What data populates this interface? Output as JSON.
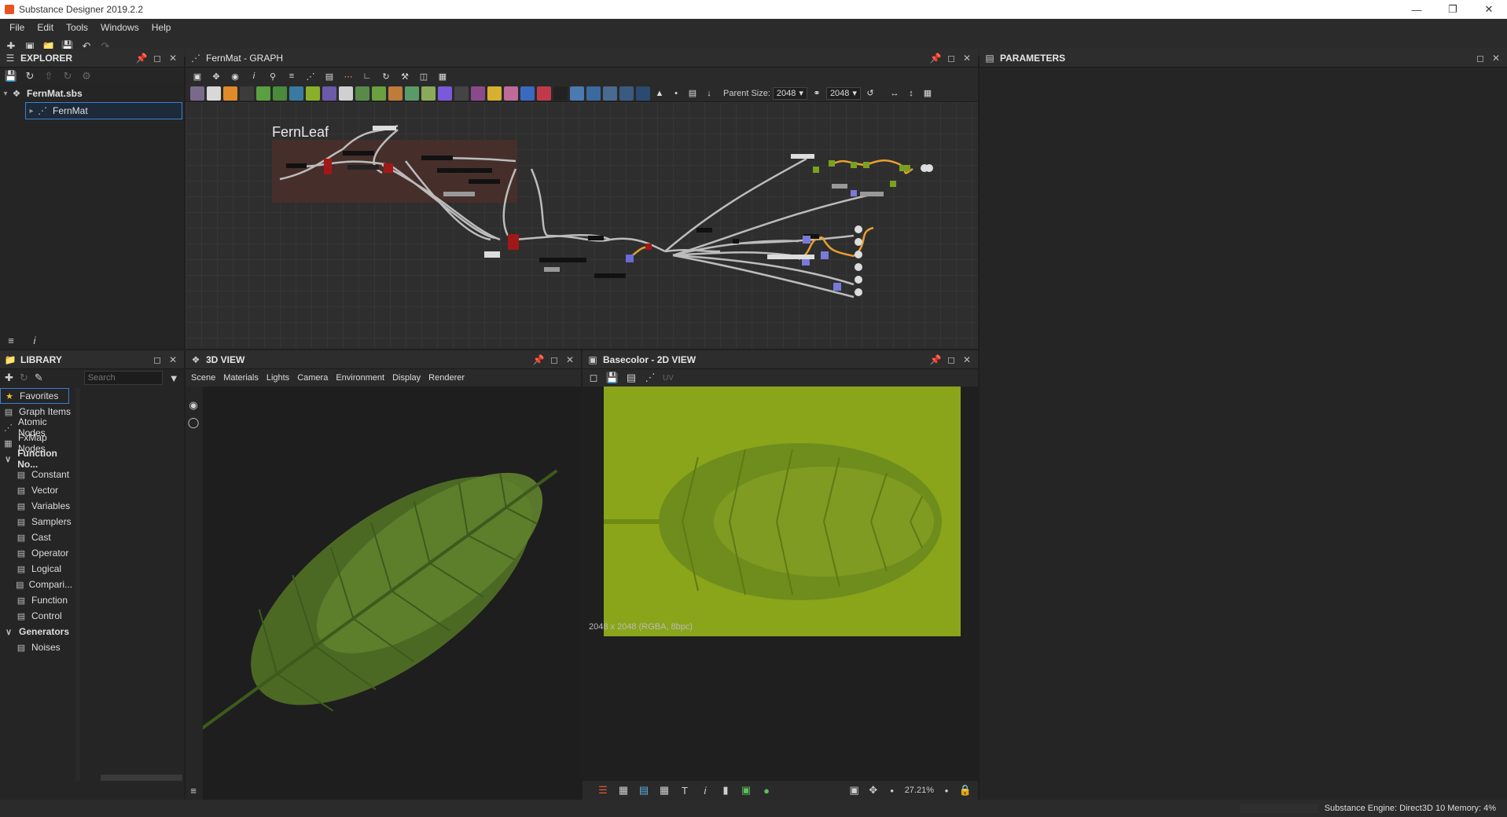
{
  "window": {
    "title": "Substance Designer 2019.2.2"
  },
  "menu": [
    "File",
    "Edit",
    "Tools",
    "Windows",
    "Help"
  ],
  "explorer": {
    "title": "EXPLORER",
    "package": "FernMat.sbs",
    "graph_item": "FernMat"
  },
  "graph": {
    "title": "FernMat - GRAPH",
    "frame_label": "FernLeaf",
    "parent_size_label": "Parent Size:",
    "parent_size_value": "2048",
    "output_size_value": "2048"
  },
  "parameters": {
    "title": "PARAMETERS"
  },
  "library": {
    "title": "LIBRARY",
    "search_placeholder": "Search",
    "categories": [
      {
        "label": "Favorites",
        "icon": "star-icon"
      },
      {
        "label": "Graph Items",
        "icon": "graph-items-icon"
      },
      {
        "label": "Atomic Nodes",
        "icon": "atomic-nodes-icon"
      },
      {
        "label": "FxMap Nodes",
        "icon": "fxmap-icon"
      },
      {
        "label": "Function No...",
        "icon": "chevron-down-icon"
      },
      {
        "label": "Constant",
        "icon": "function-icon"
      },
      {
        "label": "Vector",
        "icon": "function-icon"
      },
      {
        "label": "Variables",
        "icon": "function-icon"
      },
      {
        "label": "Samplers",
        "icon": "function-icon"
      },
      {
        "label": "Cast",
        "icon": "function-icon"
      },
      {
        "label": "Operator",
        "icon": "function-icon"
      },
      {
        "label": "Logical",
        "icon": "function-icon"
      },
      {
        "label": "Compari...",
        "icon": "function-icon"
      },
      {
        "label": "Function",
        "icon": "function-icon"
      },
      {
        "label": "Control",
        "icon": "function-icon"
      },
      {
        "label": "Generators",
        "icon": "chevron-down-icon"
      },
      {
        "label": "Noises",
        "icon": "folder-icon"
      }
    ]
  },
  "view3d": {
    "title": "3D VIEW",
    "menu": [
      "Scene",
      "Materials",
      "Lights",
      "Camera",
      "Environment",
      "Display",
      "Renderer"
    ]
  },
  "view2d": {
    "title": "Basecolor - 2D VIEW",
    "uv_label": "UV",
    "image_info": "2048 x 2048 (RGBA, 8bpc)",
    "zoom": "27.21%"
  },
  "status": {
    "text": "Substance Engine: Direct3D 10  Memory: 4%"
  },
  "colors": {
    "accent": "#3b7fd4",
    "leaf_green": "#5a7d2a",
    "basecolor_bg": "#8aa51a"
  }
}
